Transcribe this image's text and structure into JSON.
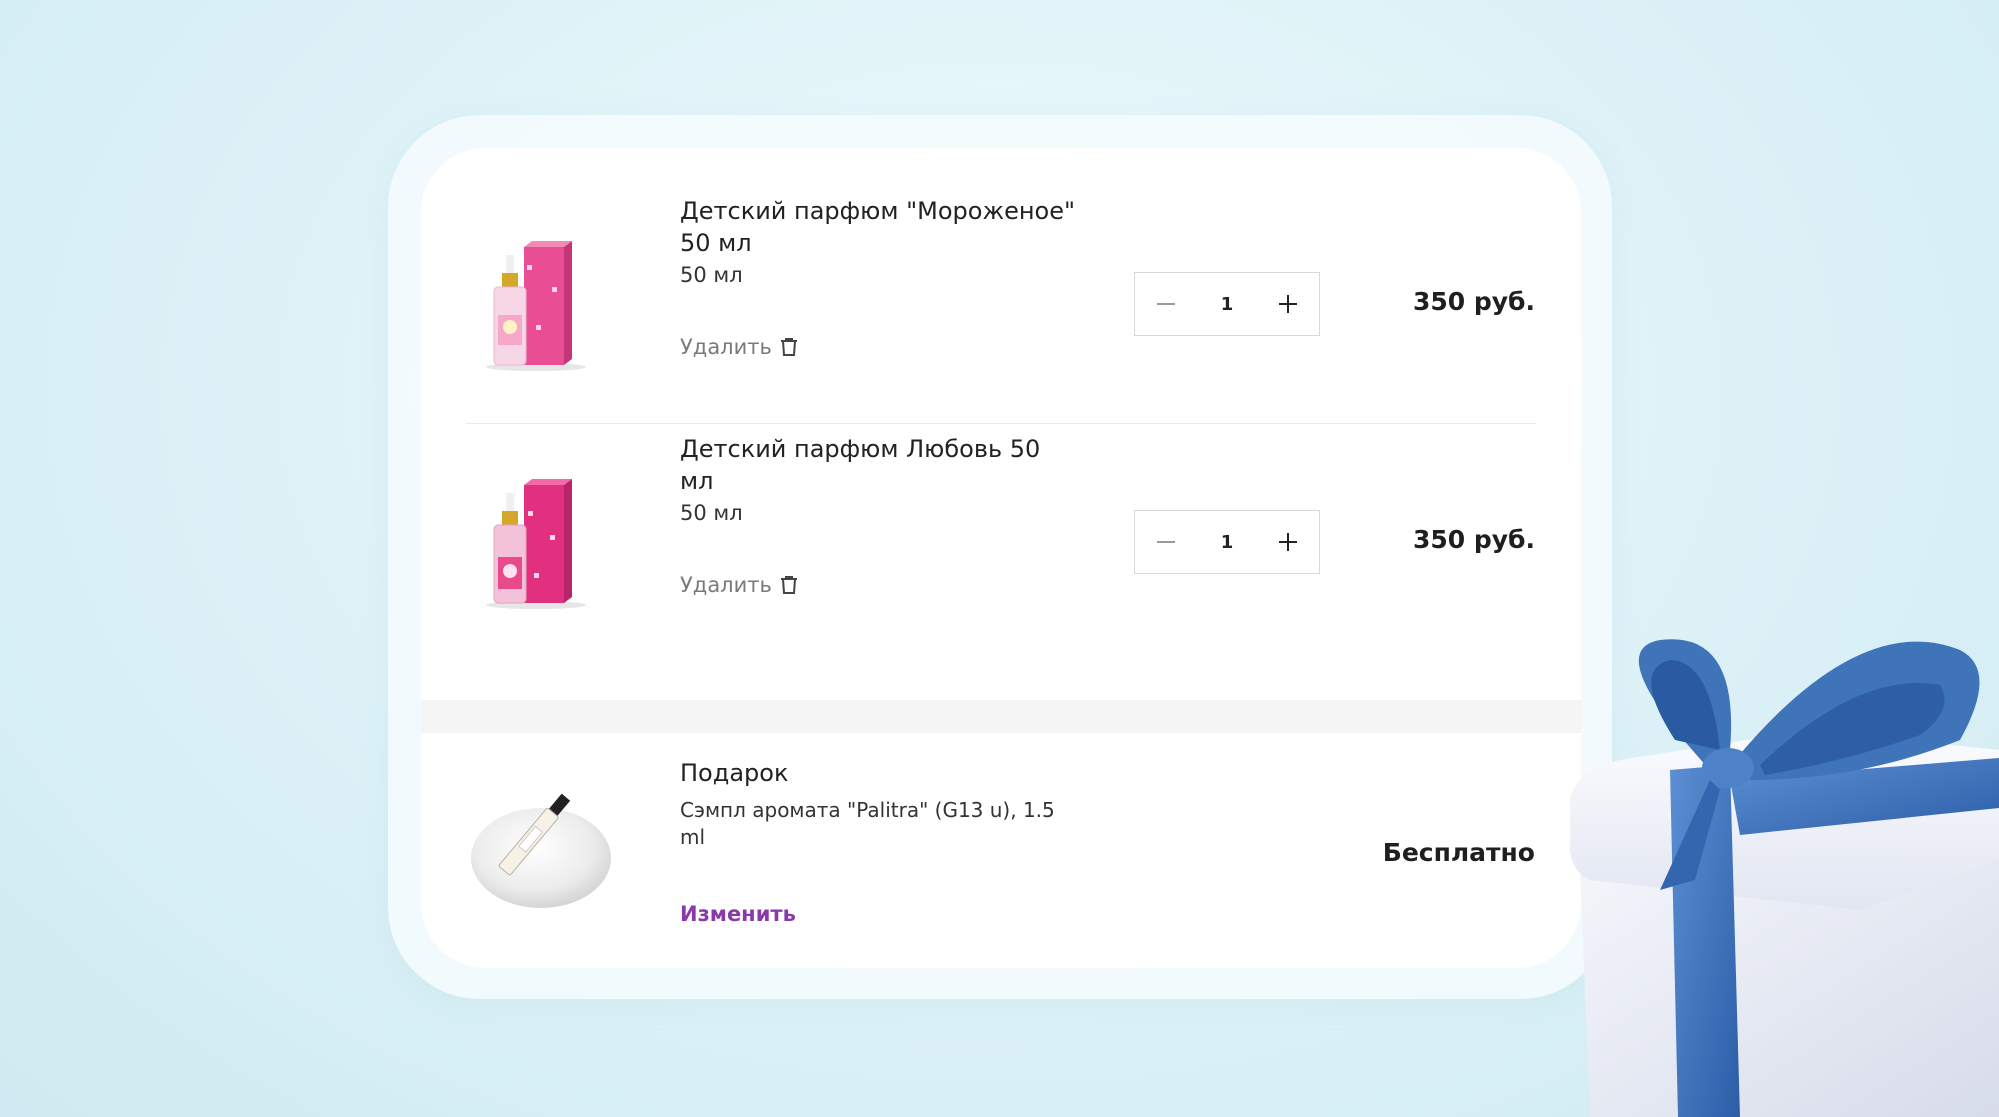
{
  "cart": {
    "items": [
      {
        "name": "Детский парфюм \"Мороженое\" 50 мл",
        "volume": "50 мл",
        "remove_label": "Удалить",
        "quantity": "1",
        "price": "350 руб."
      },
      {
        "name": "Детский парфюм Любовь 50 мл",
        "volume": "50 мл",
        "remove_label": "Удалить",
        "quantity": "1",
        "price": "350 руб."
      }
    ],
    "gift": {
      "title": "Подарок",
      "description": "Сэмпл аромата \"Palitra\" (G13 u), 1.5 ml",
      "change_label": "Изменить",
      "price": "Бесплатно"
    }
  },
  "colors": {
    "accent_link": "#8a3aa8",
    "background": "#dff3f8",
    "gift_ribbon": "#3f74b8"
  },
  "icons": [
    "minus-icon",
    "plus-icon",
    "trash-icon"
  ]
}
